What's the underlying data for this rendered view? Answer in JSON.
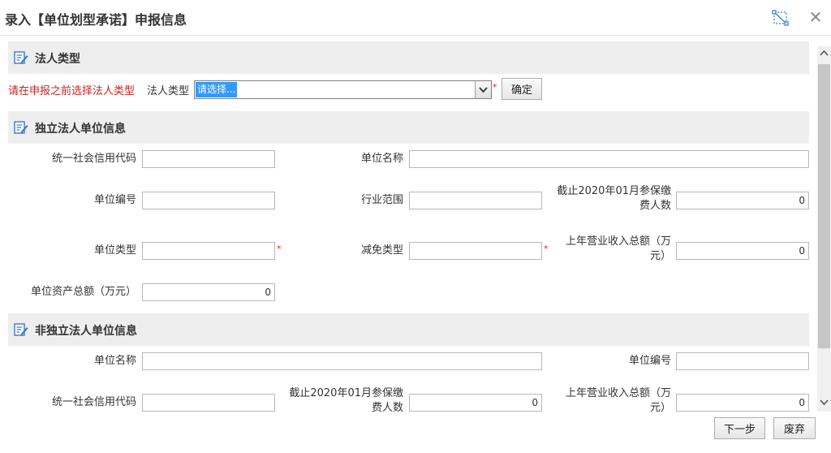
{
  "dialog": {
    "title": "录入【单位划型承诺】申报信息"
  },
  "legal_type": {
    "section_title": "法人类型",
    "hint": "请在申报之前选择法人类型",
    "label": "法人类型",
    "selected": "请选择...",
    "confirm_label": "确定"
  },
  "independent": {
    "section_title": "独立法人单位信息",
    "credit_code_label": "统一社会信用代码",
    "credit_code_value": "",
    "unit_name_label": "单位名称",
    "unit_name_value": "",
    "unit_no_label": "单位编号",
    "unit_no_value": "",
    "industry_label": "行业范围",
    "industry_value": "",
    "insured_label_1": "截止2020年01月参保缴",
    "insured_label_2": "费人数",
    "insured_value": "0",
    "unit_type_label": "单位类型",
    "unit_type_value": "",
    "relief_type_label": "减免类型",
    "relief_type_value": "",
    "revenue_label_1": "上年营业收入总额（万",
    "revenue_label_2": "元）",
    "revenue_value": "0",
    "assets_label": "单位资产总额（万元）",
    "assets_value": "0",
    "required_mark": "*"
  },
  "non_independent": {
    "section_title": "非独立法人单位信息",
    "unit_name_label": "单位名称",
    "unit_name_value": "",
    "unit_no_label": "单位编号",
    "unit_no_value": "",
    "credit_code_label": "统一社会信用代码",
    "credit_code_value": "",
    "insured_label_1": "截止2020年01月参保缴",
    "insured_label_2": "费人数",
    "insured_value": "0",
    "revenue_label_1": "上年营业收入总额（万",
    "revenue_label_2": "元）",
    "revenue_value": "0"
  },
  "footer": {
    "next_label": "下一步",
    "discard_label": "废弃"
  },
  "colors": {
    "hint": "#cc2222",
    "required": "#e02020",
    "select_highlight": "#3399ff",
    "section_bg": "#eeeeee",
    "icon": "#3a78c8"
  },
  "icons": [
    "maximize-icon",
    "close-icon",
    "edit-icon",
    "chevron-down-icon",
    "scroll-up-icon",
    "scroll-down-icon"
  ]
}
